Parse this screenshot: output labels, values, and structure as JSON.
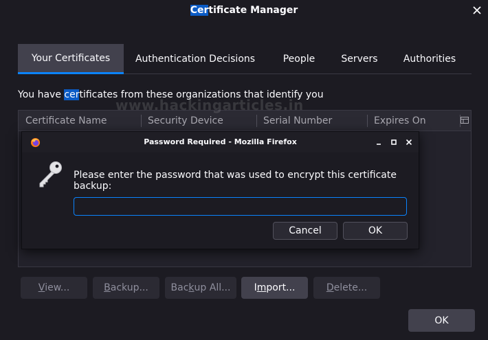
{
  "window": {
    "title_highlight": "Cer",
    "title_rest": "tificate Manager"
  },
  "tabs": [
    {
      "label": "Your Certificates",
      "active": true
    },
    {
      "label": "Authentication Decisions",
      "active": false
    },
    {
      "label": "People",
      "active": false
    },
    {
      "label": "Servers",
      "active": false
    },
    {
      "label": "Authorities",
      "active": false
    }
  ],
  "intro": {
    "before": "You have ",
    "highlight": "cer",
    "after": "tificates from these organizations that identify you"
  },
  "watermark": "www.hackingarticles.in",
  "table": {
    "columns": [
      "Certificate Name",
      "Security Device",
      "Serial Number",
      "Expires On"
    ]
  },
  "actions": {
    "view": {
      "u": "V",
      "rest": "iew..."
    },
    "backup": {
      "u": "B",
      "rest": "ackup..."
    },
    "backup_all": {
      "pre": "Bac",
      "u": "k",
      "rest": "up All..."
    },
    "import": {
      "pre": "I",
      "u": "m",
      "rest": "port..."
    },
    "delete": {
      "u": "D",
      "rest": "elete..."
    }
  },
  "ok_label": "OK",
  "dialog": {
    "title": "Password Required - Mozilla Firefox",
    "message": "Please enter the password that was used to encrypt this certificate backup:",
    "password_value": "",
    "cancel_label": "Cancel",
    "ok_label": "OK"
  },
  "colors": {
    "accent": "#0b84ff",
    "highlight": "#0b5bc5",
    "background": "#1c1b22"
  }
}
